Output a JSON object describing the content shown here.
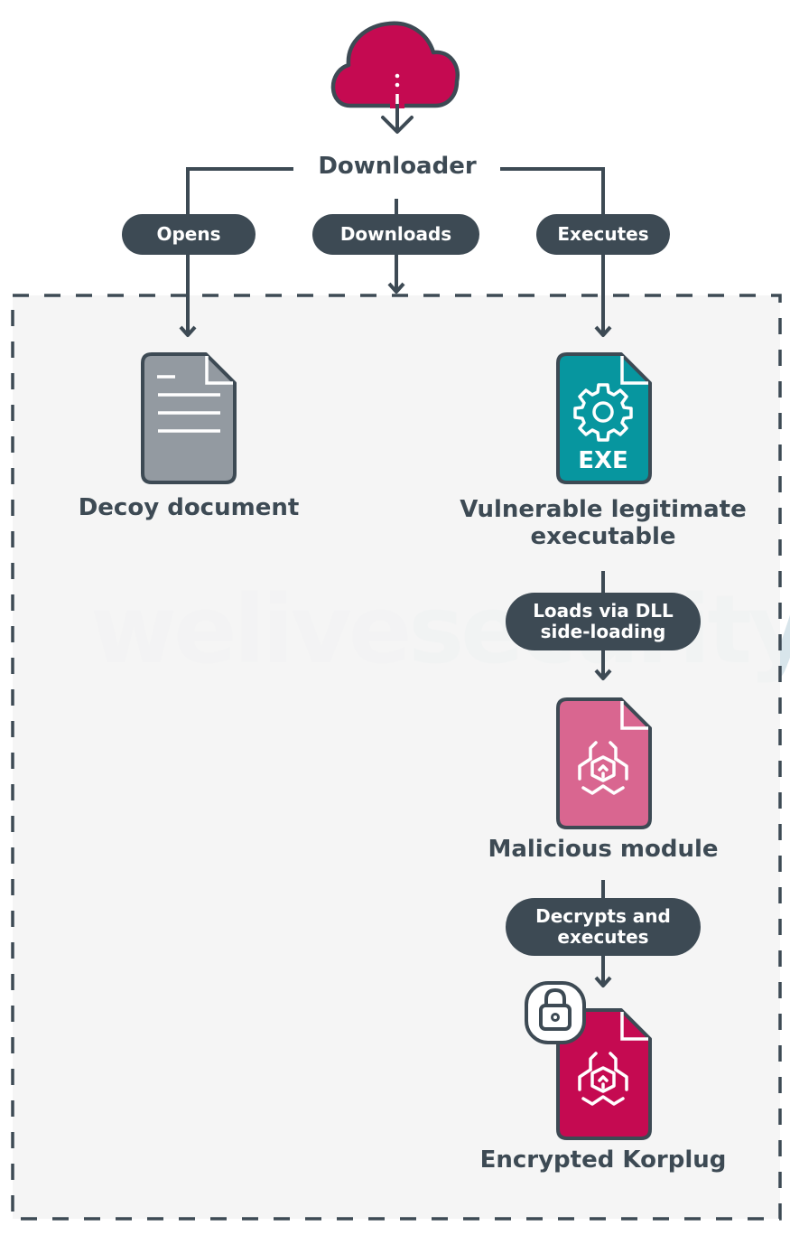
{
  "colors": {
    "ink": "#3d4a54",
    "cloud": "#c50a51",
    "decoy_doc": "#939aa1",
    "exe_doc": "#07969f",
    "malicious_doc": "#d96690",
    "encrypted_doc": "#c50a51",
    "container_bg": "#f4f4f4"
  },
  "watermark": {
    "part1": "welive",
    "part2": "security"
  },
  "nodes": {
    "downloader": {
      "label": "Downloader",
      "icon": "cloud-download-icon"
    },
    "decoy": {
      "label": "Decoy document",
      "icon": "document-icon"
    },
    "exe": {
      "label_line1": "Vulnerable legitimate",
      "label_line2": "executable",
      "icon": "exe-file-icon",
      "badge": "EXE"
    },
    "malicious": {
      "label": "Malicious module",
      "icon": "biohazard-file-icon"
    },
    "korplug": {
      "label": "Encrypted Korplug",
      "icon": "encrypted-biohazard-file-icon",
      "lock_icon": "lock-icon"
    }
  },
  "edges": {
    "opens": "Opens",
    "downloads": "Downloads",
    "executes": "Executes",
    "loads_line1": "Loads via DLL",
    "loads_line2": "side-loading",
    "decrypts_line1": "Decrypts and",
    "decrypts_line2": "executes"
  }
}
